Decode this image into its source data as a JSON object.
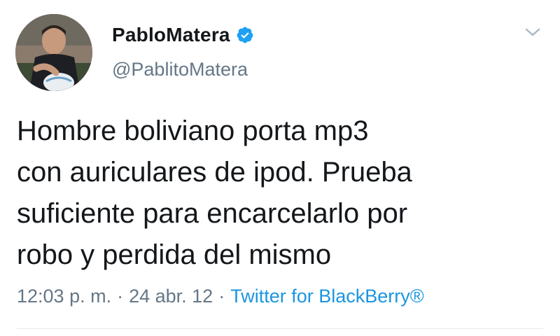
{
  "user": {
    "display_name": "PabloMatera",
    "handle": "@PablitoMatera",
    "verified_icon": "verified-badge-icon"
  },
  "tweet": {
    "text": "Hombre boliviano porta mp3\ncon auriculares de ipod. Prueba\nsuficiente para encarcelarlo por\nrobo y perdida del mismo",
    "time": "12:03 p. m.",
    "separator": "·",
    "date": "24 abr. 12",
    "source": "Twitter for BlackBerry®"
  },
  "icons": {
    "menu": "chevron-down-icon",
    "verified": "verified-badge-icon"
  },
  "colors": {
    "primary_text": "#14171a",
    "secondary_text": "#657786",
    "link": "#1b95e0",
    "verified": "#1da1f2",
    "divider": "#e6ecf0"
  }
}
